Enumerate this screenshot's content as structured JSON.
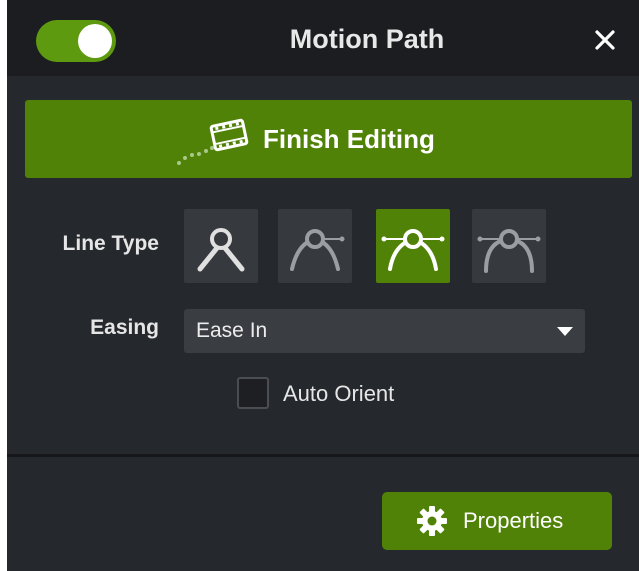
{
  "header": {
    "toggle_state": "on",
    "title": "Motion Path",
    "close_icon": "close-icon"
  },
  "finish_button": {
    "label": "Finish Editing",
    "icon": "film-path-icon"
  },
  "line_type": {
    "label": "Line Type",
    "options": [
      {
        "icon": "line-type-angle-icon",
        "active": false
      },
      {
        "icon": "line-type-curve-icon",
        "active": false
      },
      {
        "icon": "line-type-auto-curve-icon",
        "active": true
      },
      {
        "icon": "line-type-bezier-icon",
        "active": false
      }
    ]
  },
  "easing": {
    "label": "Easing",
    "selected": "Ease In"
  },
  "auto_orient": {
    "label": "Auto Orient",
    "checked": false
  },
  "footer": {
    "properties_label": "Properties",
    "properties_icon": "gear-icon"
  },
  "colors": {
    "accent_green": "#4f8206",
    "toggle_green": "#5e9a10",
    "panel_bg": "#25282c",
    "header_bg": "#1b1d20"
  }
}
